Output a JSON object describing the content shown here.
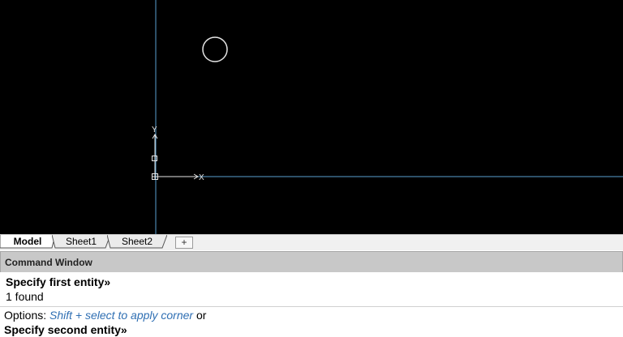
{
  "tabs": {
    "items": [
      {
        "label": "Model"
      },
      {
        "label": "Sheet1"
      },
      {
        "label": "Sheet2"
      }
    ],
    "add_label": "+"
  },
  "command_window": {
    "title": "Command Window",
    "history": [
      {
        "text": "Specify first entity»"
      },
      {
        "text": "1 found"
      }
    ],
    "options": {
      "prefix": "Options: ",
      "option": "Shift + select to apply corner",
      "suffix": " or"
    },
    "prompt": "Specify second entity»"
  },
  "colors": {
    "canvas_background": "#000000",
    "grid_line": "#5aa0d0",
    "option_text": "#2f6fb3"
  },
  "ucs": {
    "x_label": "X",
    "y_label": "Y"
  }
}
